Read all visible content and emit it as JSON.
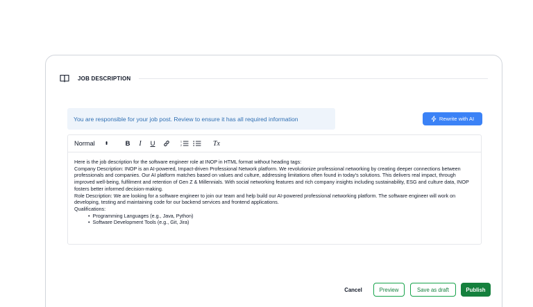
{
  "section": {
    "title": "JOB DESCRIPTION",
    "icon": "book-open-icon"
  },
  "notice": {
    "text": "You are responsible for your job post. Review to ensure it has all required information"
  },
  "rewrite_button": {
    "label": "Rewrite with AI",
    "icon": "bolt-icon"
  },
  "toolbar": {
    "format_value": "Normal",
    "bold": "B",
    "italic": "I",
    "underline": "U",
    "clear": "Tx"
  },
  "editor": {
    "intro": "Here is the job description for the software engineer role at INOP in HTML format without heading tags:",
    "company": "Company Description: INOP is an AI-powered, Impact-driven Professional Network platform. We revolutionize professional networking by creating deeper connections between professionals and companies. Our AI platform matches based on values and culture, addressing limitations often found in today's solutions. This delivers real impact, through improved well-being, fulfilment and retention of Gen Z & Millennials. With social networking features and rich company insights including sustainability, ESG and culture data, INOP fosters better informed decision-making.",
    "role": "Role Description: We are looking for a software engineer to join our team and help build our AI-powered professional networking platform. The software engineer will work on developing, testing and maintaining code for our backend services and frontend applications.",
    "qualifications_label": "Qualifications:",
    "qualifications": [
      "Programming Languages (e.g., Java, Python)",
      "Software Development Tools (e.g., Git, Jira)"
    ]
  },
  "actions": {
    "cancel": "Cancel",
    "preview": "Preview",
    "save_draft": "Save as draft",
    "publish": "Publish"
  },
  "colors": {
    "accent_blue": "#3b82f6",
    "notice_bg": "#eef4fb",
    "notice_text": "#2f6fb3",
    "publish_green": "#15803d"
  }
}
